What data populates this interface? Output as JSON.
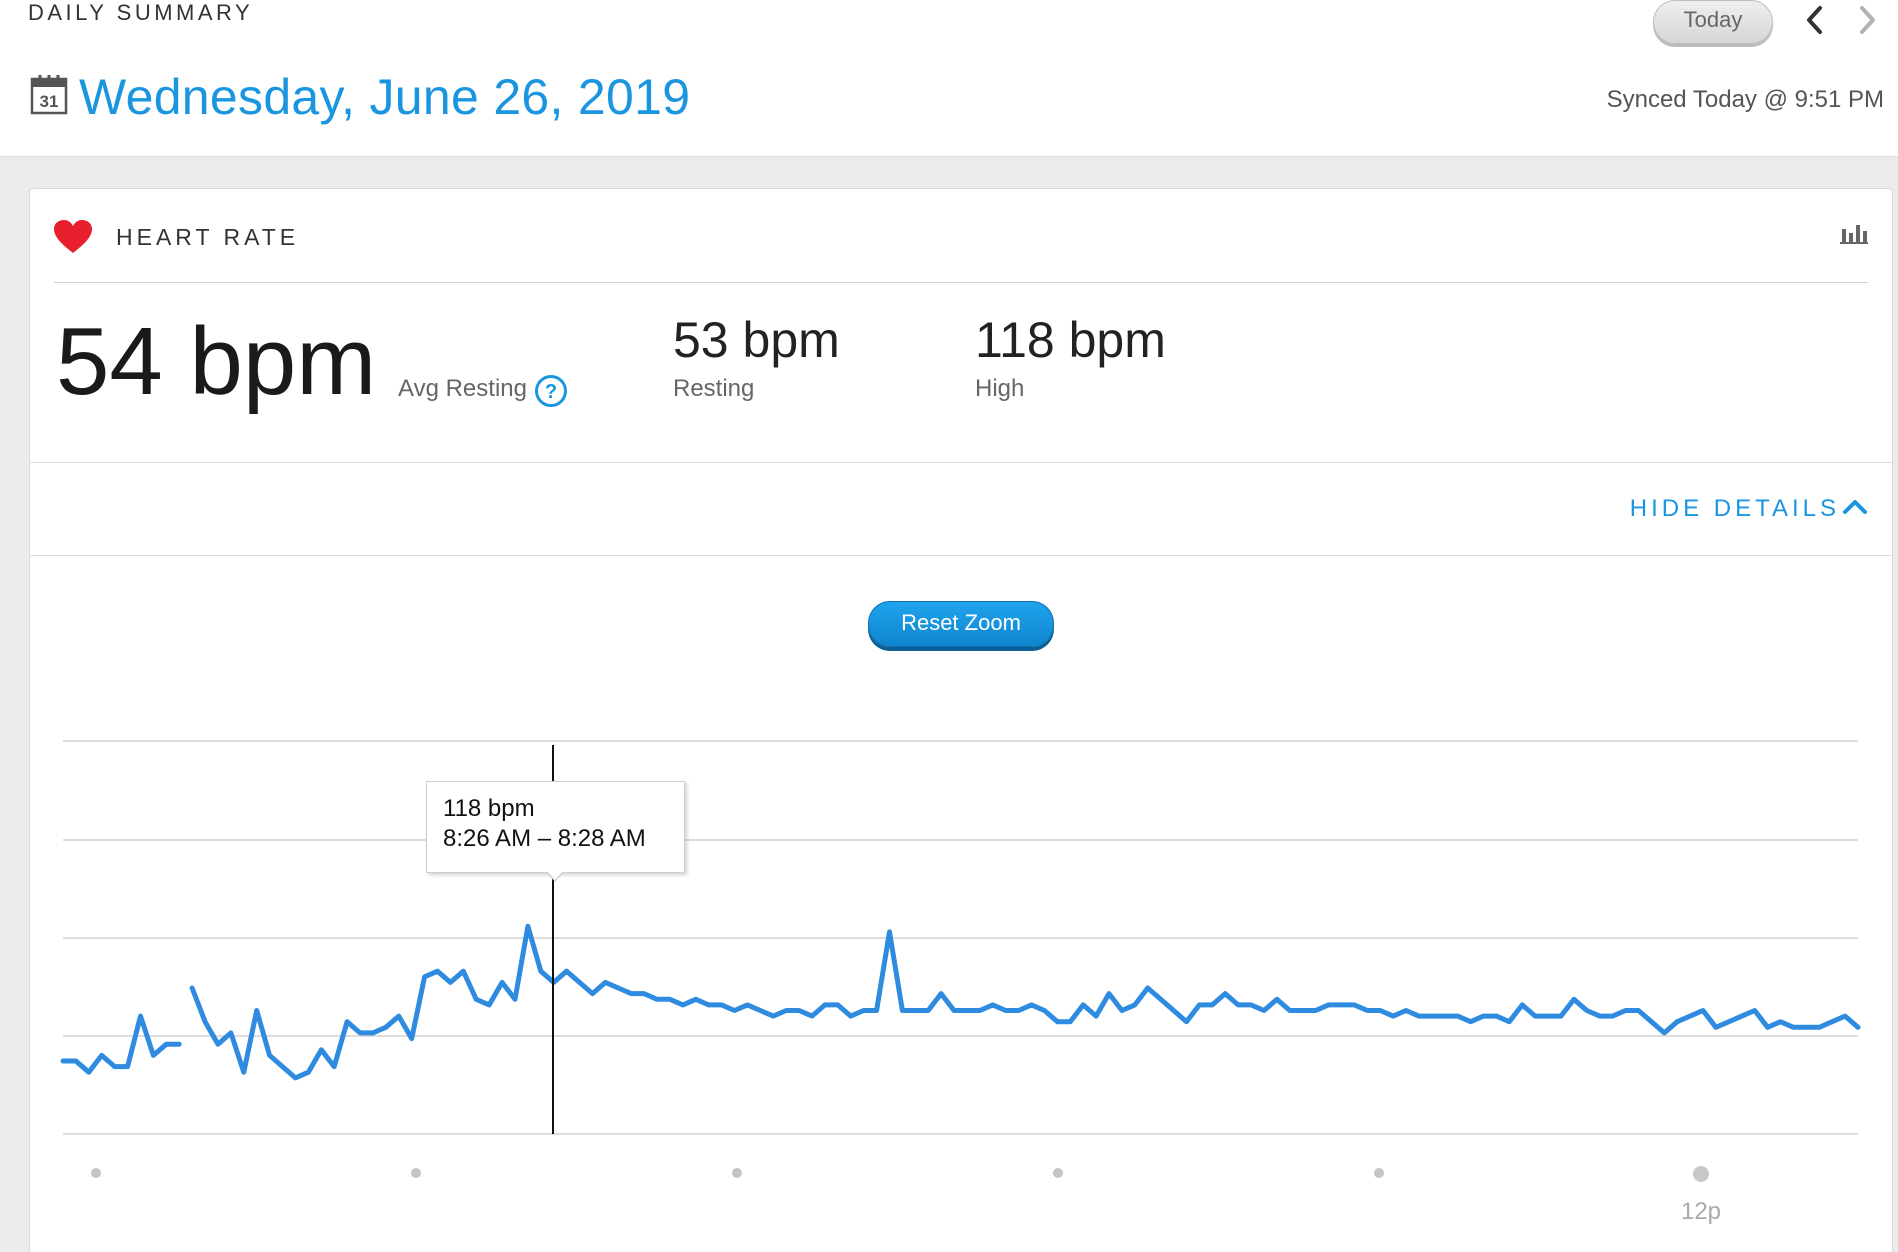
{
  "header": {
    "section_label": "DAILY SUMMARY",
    "today_button": "Today",
    "date_title": "Wednesday, June 26, 2019",
    "sync_status": "Synced Today @ 9:51 PM",
    "calendar_day": "31"
  },
  "card": {
    "title": "HEART RATE",
    "avg_resting": {
      "value": "54 bpm",
      "label": "Avg Resting"
    },
    "resting": {
      "value": "53 bpm",
      "label": "Resting"
    },
    "high": {
      "value": "118 bpm",
      "label": "High"
    },
    "hide_details": "HIDE DETAILS",
    "reset_zoom": "Reset Zoom"
  },
  "tooltip": {
    "value": "118 bpm",
    "range": "8:26 AM – 8:28 AM"
  },
  "colors": {
    "accent": "#1a96e0",
    "line": "#2e8be0",
    "heart": "#e8202d"
  },
  "chart_data": {
    "type": "line",
    "series": [
      {
        "values": [
          63,
          63,
          61,
          64,
          62,
          62,
          71,
          64,
          66,
          66,
          76,
          70,
          66,
          68,
          61,
          72,
          64,
          62,
          60,
          61,
          65,
          62,
          70,
          68,
          68,
          69,
          71,
          67,
          78,
          79,
          77,
          79,
          74,
          73,
          77,
          74,
          87,
          79,
          77,
          79,
          77,
          75,
          77,
          76,
          75,
          75,
          74,
          74,
          73,
          74,
          73,
          73,
          72,
          73,
          72,
          71,
          72,
          72,
          71,
          73,
          73,
          71,
          72,
          72,
          86,
          72,
          72,
          72,
          75,
          72,
          72,
          72,
          73,
          72,
          72,
          73,
          72,
          70,
          70,
          73,
          71,
          75,
          72,
          73,
          76,
          74,
          72,
          70,
          73,
          73,
          75,
          73,
          73,
          72,
          74,
          72,
          72,
          72,
          73,
          73,
          73,
          72,
          72,
          71,
          72,
          71,
          71,
          71,
          71,
          70,
          71,
          71,
          70,
          73,
          71,
          71,
          71,
          74,
          72,
          71,
          71,
          72,
          72,
          70,
          68,
          70,
          71,
          72,
          69,
          70,
          71,
          72,
          69,
          70,
          69,
          69,
          69,
          70,
          71,
          69
        ]
      }
    ],
    "gap_after_index": 9,
    "y_range": [
      50,
      120
    ],
    "x_tick_labels": [
      "",
      "",
      "",
      "",
      "",
      "12p"
    ],
    "highlight": {
      "index": 34,
      "value": 118
    }
  }
}
